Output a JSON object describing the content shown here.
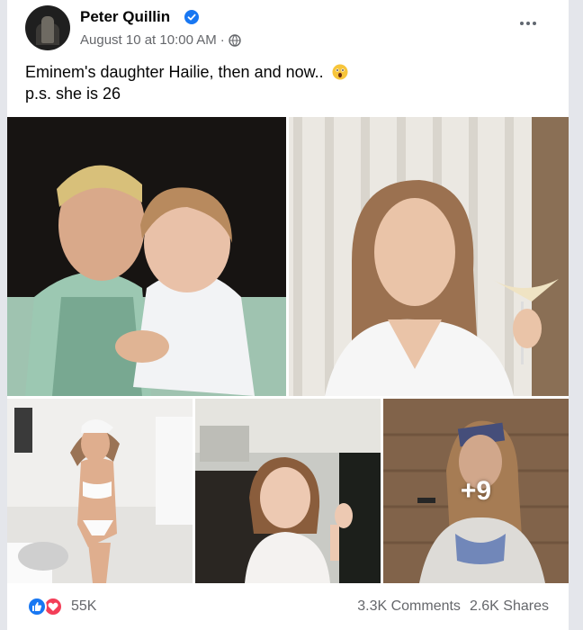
{
  "post": {
    "author": "Peter Quillin",
    "timestamp": "August 10 at 10:00 AM",
    "separator": "·",
    "text_line1": "Eminem's daughter Hailie, then and now..",
    "text_line2": "p.s. she is 26",
    "emoji": "astonished-face",
    "verified": true
  },
  "photos": {
    "extra_count": "+9"
  },
  "footer": {
    "reaction_count": "55K",
    "comments": "3.3K Comments",
    "shares": "2.6K Shares"
  },
  "colors": {
    "brand_blue": "#1877f2",
    "love_red": "#f33e58",
    "secondary_text": "#65676b"
  }
}
